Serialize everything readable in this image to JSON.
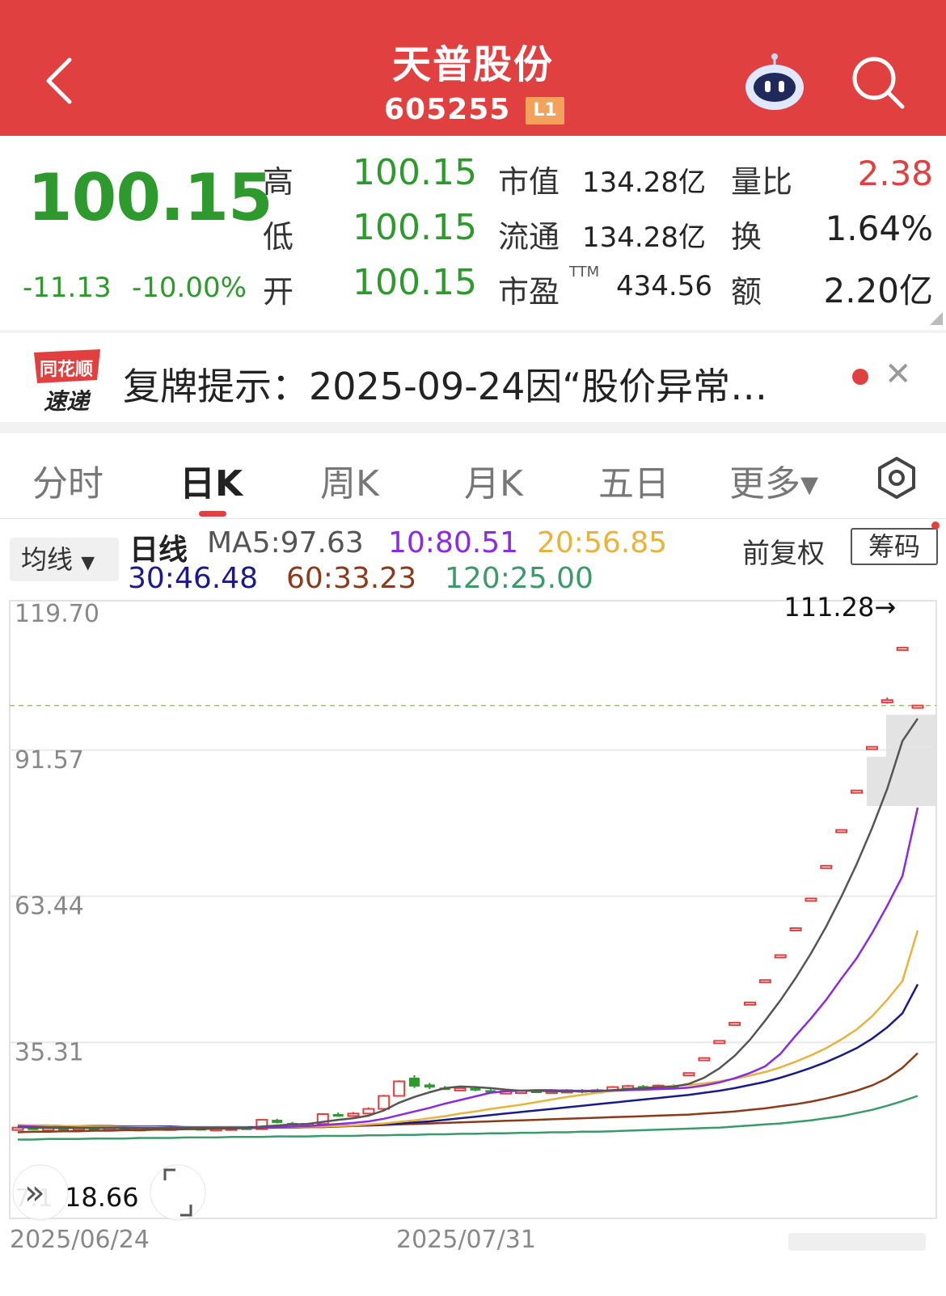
{
  "header": {
    "title": "天普股份",
    "code": "605255",
    "level_badge": "L1"
  },
  "quote": {
    "price": "100.15",
    "change": "-11.13",
    "change_pct": "-10.00%",
    "high_label": "高",
    "high": "100.15",
    "low_label": "低",
    "low": "100.15",
    "open_label": "开",
    "open": "100.15",
    "mktcap_label": "市值",
    "mktcap": "134.28亿",
    "float_label": "流通",
    "float": "134.28亿",
    "pe_label": "市盈",
    "pe_sup": "TTM",
    "pe": "434.56",
    "volratio_label": "量比",
    "volratio": "2.38",
    "turnover_label": "换",
    "turnover": "1.64%",
    "amount_label": "额",
    "amount": "2.20亿"
  },
  "news": {
    "logo_top": "同花顺",
    "logo_bottom": "速递",
    "text": "复牌提示：2025-09-24因“股价异常…"
  },
  "tabs": [
    "分时",
    "日K",
    "周K",
    "月K",
    "五日",
    "更多▾"
  ],
  "legend": {
    "ma_button": "均线",
    "kline_label": "日线",
    "ma5": "MA5:97.63",
    "ma10": "10:80.51",
    "ma20": "20:56.85",
    "ma30": "30:46.48",
    "ma60": "60:33.23",
    "ma120": "120:25.00",
    "adjust": "前复权",
    "chips": "筹码"
  },
  "colors": {
    "red": "#e0403f",
    "green": "#2e9a2e",
    "ma5": "#555555",
    "ma10": "#8a2be2",
    "ma20": "#e8b33c",
    "ma30": "#1a1a8c",
    "ma60": "#8b3a1a",
    "ma120": "#3a9a6a"
  },
  "chart_data": {
    "type": "candlestick",
    "y_ticks": [
      "119.70",
      "91.57",
      "63.44",
      "35.31"
    ],
    "ylim": [
      7.18,
      119.7
    ],
    "x_labels": [
      "2025/06/24",
      "2025/07/31"
    ],
    "max_label": "111.28→",
    "min_label": "18.66",
    "min_tick_partial": "7.1",
    "last_close": 100.15,
    "candles": [
      {
        "o": 18.6,
        "c": 18.9,
        "h": 19.1,
        "l": 18.5
      },
      {
        "o": 18.9,
        "c": 18.7,
        "h": 19.0,
        "l": 18.6
      },
      {
        "o": 18.7,
        "c": 18.8,
        "h": 19.0,
        "l": 18.6
      },
      {
        "o": 18.8,
        "c": 18.7,
        "h": 18.9,
        "l": 18.6
      },
      {
        "o": 18.7,
        "c": 18.9,
        "h": 19.0,
        "l": 18.6
      },
      {
        "o": 18.9,
        "c": 18.8,
        "h": 19.0,
        "l": 18.7
      },
      {
        "o": 18.8,
        "c": 18.9,
        "h": 19.1,
        "l": 18.7
      },
      {
        "o": 18.9,
        "c": 18.7,
        "h": 19.0,
        "l": 18.6
      },
      {
        "o": 18.7,
        "c": 18.8,
        "h": 18.9,
        "l": 18.6
      },
      {
        "o": 18.8,
        "c": 18.7,
        "h": 18.9,
        "l": 18.6
      },
      {
        "o": 18.7,
        "c": 18.9,
        "h": 19.0,
        "l": 18.6
      },
      {
        "o": 18.9,
        "c": 18.8,
        "h": 19.0,
        "l": 18.7
      },
      {
        "o": 18.8,
        "c": 18.7,
        "h": 18.9,
        "l": 18.6
      },
      {
        "o": 18.7,
        "c": 18.8,
        "h": 18.9,
        "l": 18.6
      },
      {
        "o": 18.8,
        "c": 18.9,
        "h": 19.0,
        "l": 18.7
      },
      {
        "o": 18.9,
        "c": 18.6,
        "h": 19.0,
        "l": 18.5
      },
      {
        "o": 18.6,
        "c": 20.4,
        "h": 20.5,
        "l": 18.6
      },
      {
        "o": 20.4,
        "c": 19.8,
        "h": 20.6,
        "l": 19.7
      },
      {
        "o": 19.8,
        "c": 19.5,
        "h": 20.0,
        "l": 19.4
      },
      {
        "o": 19.5,
        "c": 19.6,
        "h": 19.8,
        "l": 19.3
      },
      {
        "o": 19.6,
        "c": 21.5,
        "h": 21.7,
        "l": 19.6
      },
      {
        "o": 21.5,
        "c": 21.2,
        "h": 21.8,
        "l": 21.0
      },
      {
        "o": 21.2,
        "c": 21.6,
        "h": 21.9,
        "l": 21.0
      },
      {
        "o": 21.6,
        "c": 22.5,
        "h": 22.8,
        "l": 21.5
      },
      {
        "o": 22.5,
        "c": 25.0,
        "h": 25.2,
        "l": 22.4
      },
      {
        "o": 25.0,
        "c": 27.8,
        "h": 28.0,
        "l": 24.9
      },
      {
        "o": 28.5,
        "c": 26.8,
        "h": 29.0,
        "l": 26.5
      },
      {
        "o": 27.2,
        "c": 26.6,
        "h": 27.5,
        "l": 26.3
      },
      {
        "o": 26.6,
        "c": 26.4,
        "h": 26.9,
        "l": 26.2
      },
      {
        "o": 26.4,
        "c": 26.5,
        "h": 26.8,
        "l": 26.2
      },
      {
        "o": 26.5,
        "c": 26.1,
        "h": 26.7,
        "l": 25.9
      },
      {
        "o": 26.1,
        "c": 25.8,
        "h": 26.3,
        "l": 25.6
      },
      {
        "o": 25.8,
        "c": 25.9,
        "h": 26.1,
        "l": 25.6
      },
      {
        "o": 25.9,
        "c": 26.0,
        "h": 26.2,
        "l": 25.7
      },
      {
        "o": 26.0,
        "c": 25.9,
        "h": 26.2,
        "l": 25.7
      },
      {
        "o": 25.9,
        "c": 26.0,
        "h": 26.2,
        "l": 25.7
      },
      {
        "o": 26.0,
        "c": 26.1,
        "h": 26.3,
        "l": 25.8
      },
      {
        "o": 26.1,
        "c": 25.7,
        "h": 26.3,
        "l": 25.5
      },
      {
        "o": 25.7,
        "c": 26.1,
        "h": 26.4,
        "l": 25.6
      },
      {
        "o": 26.1,
        "c": 26.7,
        "h": 26.9,
        "l": 26.0
      },
      {
        "o": 26.7,
        "c": 26.9,
        "h": 27.1,
        "l": 26.5
      },
      {
        "o": 26.9,
        "c": 26.8,
        "h": 27.1,
        "l": 26.6
      },
      {
        "o": 26.8,
        "c": 27.0,
        "h": 27.2,
        "l": 26.6
      },
      {
        "o": 27.0,
        "c": 26.6,
        "h": 27.2,
        "l": 26.4
      },
      {
        "o": 29.4,
        "c": 29.4,
        "h": 29.4,
        "l": 29.4
      },
      {
        "o": 32.3,
        "c": 32.3,
        "h": 32.3,
        "l": 32.3
      },
      {
        "o": 35.6,
        "c": 35.6,
        "h": 35.6,
        "l": 35.6
      },
      {
        "o": 39.1,
        "c": 39.1,
        "h": 39.1,
        "l": 39.1
      },
      {
        "o": 43.0,
        "c": 43.0,
        "h": 43.0,
        "l": 43.0
      },
      {
        "o": 47.3,
        "c": 47.3,
        "h": 47.3,
        "l": 47.3
      },
      {
        "o": 52.1,
        "c": 52.1,
        "h": 52.1,
        "l": 52.1
      },
      {
        "o": 57.3,
        "c": 57.3,
        "h": 57.3,
        "l": 57.3
      },
      {
        "o": 63.0,
        "c": 63.0,
        "h": 63.0,
        "l": 63.0
      },
      {
        "o": 69.3,
        "c": 69.3,
        "h": 69.3,
        "l": 69.3
      },
      {
        "o": 76.2,
        "c": 76.2,
        "h": 76.2,
        "l": 76.2
      },
      {
        "o": 83.8,
        "c": 83.8,
        "h": 83.8,
        "l": 83.8
      },
      {
        "o": 92.2,
        "c": 92.2,
        "h": 92.2,
        "l": 92.2
      },
      {
        "o": 101.2,
        "c": 101.2,
        "h": 101.7,
        "l": 100.5
      },
      {
        "o": 111.28,
        "c": 111.28,
        "h": 111.28,
        "l": 111.28
      },
      {
        "o": 100.15,
        "c": 100.15,
        "h": 100.15,
        "l": 100.15
      }
    ],
    "ma": {
      "ma5": [
        19.0,
        18.9,
        18.8,
        18.8,
        18.8,
        18.8,
        18.8,
        18.8,
        18.8,
        18.8,
        18.8,
        18.8,
        18.8,
        18.8,
        18.8,
        18.8,
        19.1,
        19.3,
        19.5,
        19.6,
        20.0,
        20.4,
        20.7,
        21.2,
        22.2,
        23.7,
        24.8,
        25.7,
        26.5,
        26.8,
        26.7,
        26.5,
        26.2,
        26.0,
        26.0,
        25.9,
        25.9,
        25.9,
        25.9,
        26.1,
        26.3,
        26.5,
        26.7,
        26.8,
        27.3,
        28.5,
        30.3,
        32.7,
        35.8,
        39.5,
        43.4,
        47.7,
        52.4,
        57.6,
        63.4,
        69.6,
        76.5,
        84.1,
        93.3,
        97.63
      ],
      "ma10": [
        19.2,
        19.1,
        19.0,
        19.0,
        18.9,
        18.9,
        18.9,
        18.9,
        18.8,
        18.8,
        18.8,
        18.8,
        18.8,
        18.8,
        18.8,
        18.8,
        18.9,
        19.0,
        19.1,
        19.2,
        19.4,
        19.6,
        19.8,
        20.1,
        20.6,
        21.3,
        22.0,
        22.7,
        23.5,
        24.2,
        24.9,
        25.6,
        25.9,
        26.0,
        26.1,
        26.1,
        26.0,
        26.0,
        26.0,
        26.0,
        26.1,
        26.2,
        26.3,
        26.4,
        26.6,
        27.0,
        27.6,
        28.4,
        29.4,
        30.7,
        33.1,
        36.6,
        39.9,
        43.5,
        47.6,
        51.5,
        56.3,
        61.6,
        67.3,
        80.51
      ],
      "ma20": [
        19.4,
        19.3,
        19.3,
        19.2,
        19.2,
        19.1,
        19.1,
        19.0,
        19.0,
        19.0,
        18.9,
        18.9,
        18.9,
        18.9,
        18.9,
        18.9,
        18.9,
        19.0,
        19.0,
        19.1,
        19.1,
        19.2,
        19.3,
        19.5,
        19.7,
        20.0,
        20.3,
        20.7,
        21.1,
        21.6,
        22.0,
        22.5,
        22.9,
        23.3,
        23.8,
        24.3,
        24.8,
        25.2,
        25.6,
        26.0,
        26.3,
        26.5,
        26.7,
        26.9,
        27.1,
        27.4,
        27.8,
        28.3,
        28.9,
        29.6,
        30.5,
        31.6,
        32.8,
        34.2,
        35.9,
        37.8,
        40.3,
        43.5,
        47.1,
        56.85
      ],
      "ma30": [
        19.3,
        19.3,
        19.3,
        19.2,
        19.2,
        19.2,
        19.2,
        19.1,
        19.1,
        19.1,
        19.1,
        19.0,
        19.0,
        19.0,
        19.0,
        19.0,
        19.0,
        19.0,
        19.0,
        19.1,
        19.1,
        19.2,
        19.3,
        19.4,
        19.5,
        19.7,
        19.9,
        20.1,
        20.4,
        20.7,
        21.0,
        21.3,
        21.6,
        21.9,
        22.2,
        22.5,
        22.8,
        23.1,
        23.4,
        23.7,
        24.0,
        24.3,
        24.6,
        24.9,
        25.2,
        25.6,
        26.0,
        26.5,
        27.1,
        27.7,
        28.5,
        29.4,
        30.4,
        31.5,
        32.8,
        34.2,
        36.0,
        38.2,
        40.9,
        46.48
      ],
      "ma60": [
        18.0,
        18.1,
        18.1,
        18.2,
        18.2,
        18.3,
        18.3,
        18.4,
        18.4,
        18.5,
        18.5,
        18.6,
        18.6,
        18.7,
        18.7,
        18.8,
        18.8,
        18.9,
        18.9,
        19.0,
        19.0,
        19.1,
        19.2,
        19.3,
        19.4,
        19.5,
        19.6,
        19.7,
        19.8,
        19.9,
        20.0,
        20.1,
        20.2,
        20.3,
        20.4,
        20.5,
        20.6,
        20.7,
        20.8,
        20.9,
        21.0,
        21.1,
        21.2,
        21.3,
        21.4,
        21.6,
        21.8,
        22.0,
        22.3,
        22.6,
        23.0,
        23.4,
        23.9,
        24.5,
        25.2,
        26.0,
        27.0,
        28.4,
        30.4,
        33.23
      ],
      "ma120": [
        16.6,
        16.6,
        16.7,
        16.7,
        16.7,
        16.8,
        16.8,
        16.8,
        16.9,
        16.9,
        16.9,
        17.0,
        17.0,
        17.0,
        17.1,
        17.1,
        17.1,
        17.2,
        17.2,
        17.2,
        17.3,
        17.3,
        17.3,
        17.4,
        17.4,
        17.5,
        17.5,
        17.6,
        17.6,
        17.7,
        17.7,
        17.8,
        17.8,
        17.9,
        17.9,
        18.0,
        18.0,
        18.1,
        18.1,
        18.2,
        18.3,
        18.4,
        18.5,
        18.6,
        18.7,
        18.8,
        18.9,
        19.1,
        19.3,
        19.5,
        19.7,
        20.0,
        20.3,
        20.7,
        21.1,
        21.7,
        22.3,
        23.1,
        24.0,
        25.0
      ]
    }
  }
}
